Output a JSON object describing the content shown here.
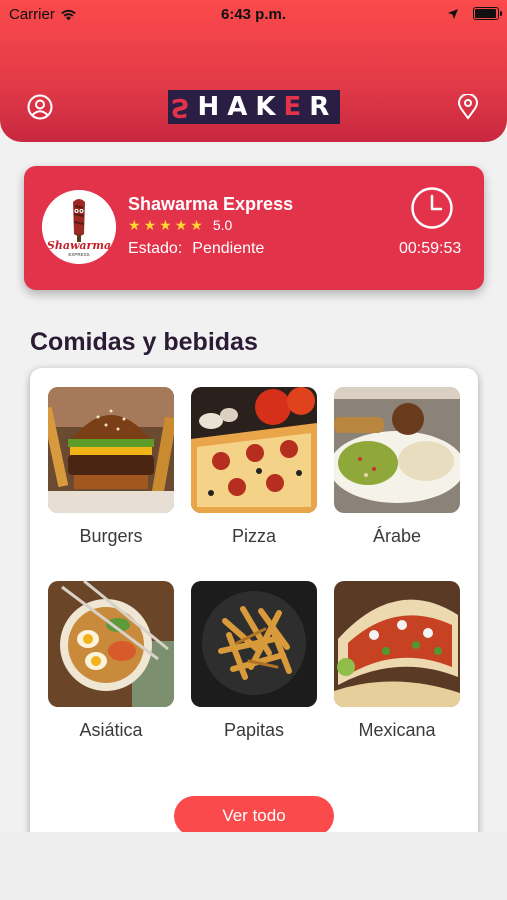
{
  "status_bar": {
    "carrier": "Carrier",
    "time": "6:43 p.m.",
    "battery_level": 0.95
  },
  "header": {
    "profile_icon": "user-circle-icon",
    "location_icon": "map-pin-icon",
    "logo_text": "SHAKER",
    "colors": {
      "gradient_top": "#fb4a4b",
      "gradient_bottom": "#c8283f",
      "logo_bg": "#2a1e45"
    }
  },
  "order": {
    "restaurant_name": "Shawarma Express",
    "logo_script": "Shawarma",
    "logo_sub": "EXPRESS",
    "stars": 5,
    "rating": "5.0",
    "status_label": "Estado:",
    "status_value": "Pendiente",
    "timer": "00:59:53",
    "color": "#e2334b"
  },
  "section": {
    "title": "Comidas y bebidas"
  },
  "categories": [
    {
      "label": "Burgers"
    },
    {
      "label": "Pizza"
    },
    {
      "label": "Árabe"
    },
    {
      "label": "Asiática"
    },
    {
      "label": "Papitas"
    },
    {
      "label": "Mexicana"
    }
  ],
  "see_all_label": "Ver todo",
  "accent": "#fb4a4b"
}
